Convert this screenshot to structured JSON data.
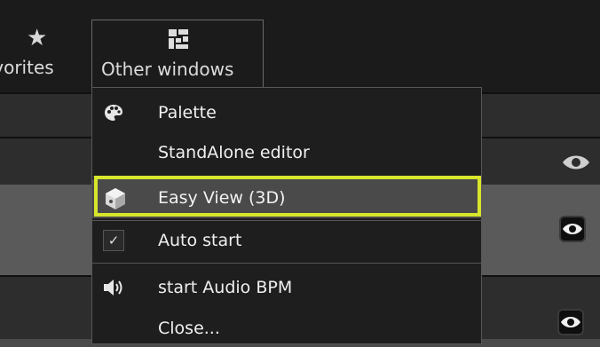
{
  "toolbar": {
    "favorites_label": "avorites",
    "other_windows_label": "Other windows"
  },
  "menu": {
    "items": [
      {
        "label": "Palette",
        "icon": "palette-icon"
      },
      {
        "label": "StandAlone editor",
        "icon": ""
      },
      {
        "label": "Easy View (3D)",
        "icon": "cube-icon"
      },
      {
        "label": "Auto start",
        "icon": "checkbox-checked-icon"
      },
      {
        "label": "start Audio BPM",
        "icon": "speaker-icon"
      },
      {
        "label": "Close...",
        "icon": ""
      }
    ]
  },
  "colors": {
    "toolbar_bg": "#1b1b1b",
    "menu_bg": "#1e1e1e",
    "highlight_border": "#d8e62b",
    "row_grey": "#5a5a5a",
    "row_dark": "#2d2d2d"
  }
}
